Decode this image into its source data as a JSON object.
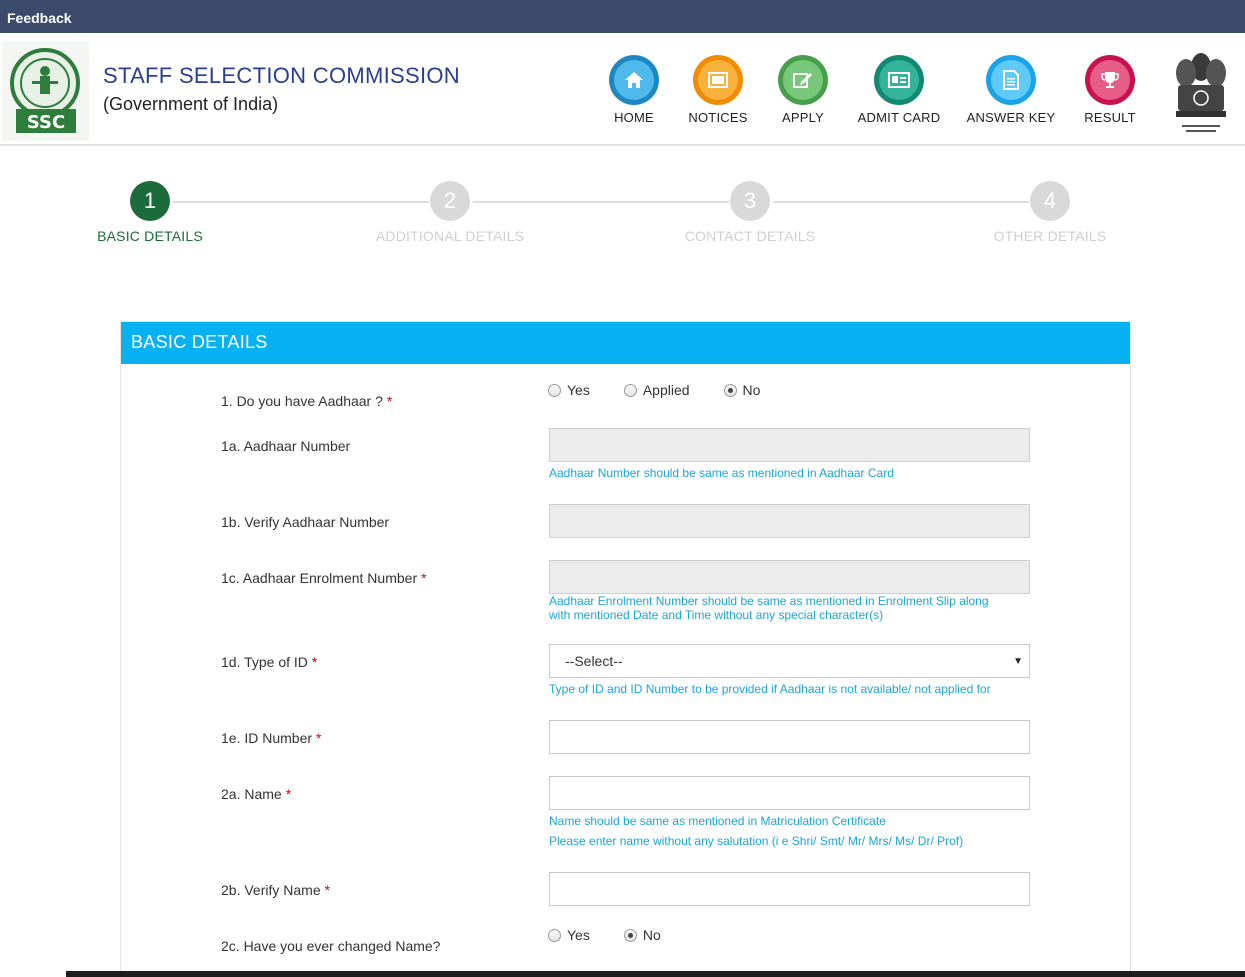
{
  "topbar": {
    "feedback": "Feedback"
  },
  "header": {
    "title": "STAFF SELECTION COMMISSION",
    "subtitle": "(Government of India)",
    "logo_icon": "ssc-logo-icon",
    "emblem_icon": "national-emblem-icon",
    "nav": [
      {
        "label": "HOME",
        "icon": "home-icon"
      },
      {
        "label": "NOTICES",
        "icon": "notices-icon"
      },
      {
        "label": "APPLY",
        "icon": "apply-edit-icon"
      },
      {
        "label": "ADMIT CARD",
        "icon": "admit-card-icon"
      },
      {
        "label": "ANSWER KEY",
        "icon": "answer-key-icon"
      },
      {
        "label": "RESULT",
        "icon": "trophy-icon"
      }
    ]
  },
  "stepper": [
    {
      "num": "1",
      "label": "BASIC DETAILS",
      "active": true
    },
    {
      "num": "2",
      "label": "ADDITIONAL DETAILS",
      "active": false
    },
    {
      "num": "3",
      "label": "CONTACT DETAILS",
      "active": false
    },
    {
      "num": "4",
      "label": "OTHER DETAILS",
      "active": false
    }
  ],
  "form": {
    "section_title": "BASIC DETAILS",
    "q1": {
      "label": "1. Do you have Aadhaar ?",
      "options": [
        "Yes",
        "Applied",
        "No"
      ],
      "selected": "No"
    },
    "q1a": {
      "label": "1a. Aadhaar Number",
      "value": "",
      "hint": "Aadhaar Number should be same as mentioned in Aadhaar Card"
    },
    "q1b": {
      "label": "1b. Verify Aadhaar Number",
      "value": ""
    },
    "q1c": {
      "label": "1c. Aadhaar Enrolment Number",
      "value": "",
      "hint_line1": "Aadhaar Enrolment Number should be same as mentioned in Enrolment Slip along",
      "hint_line2": "with mentioned Date and Time without any special character(s)"
    },
    "q1d": {
      "label": "1d. Type of ID",
      "selected": "--Select--",
      "hint": "Type of ID and ID Number to be provided if Aadhaar is not available/ not applied for"
    },
    "q1e": {
      "label": "1e. ID Number",
      "value": ""
    },
    "q2a": {
      "label": "2a. Name",
      "value": "",
      "hint_line1": "Name should be same as mentioned in Matriculation Certificate",
      "hint_line2": "Please enter name without any salutation (i e Shri/ Smt/ Mr/ Mrs/ Ms/ Dr/ Prof)"
    },
    "q2b": {
      "label": "2b. Verify Name",
      "value": ""
    },
    "q2c": {
      "label": "2c. Have you ever changed Name?",
      "options": [
        "Yes",
        "No"
      ],
      "selected": "No"
    },
    "required_mark": "*"
  },
  "colors": {
    "topbar": "#3b4a6b",
    "title": "#2a3f8f",
    "section_head": "#08b2f2",
    "active_step": "#1c6b3b",
    "hint": "#1aa6d9",
    "required": "#d0021b"
  }
}
